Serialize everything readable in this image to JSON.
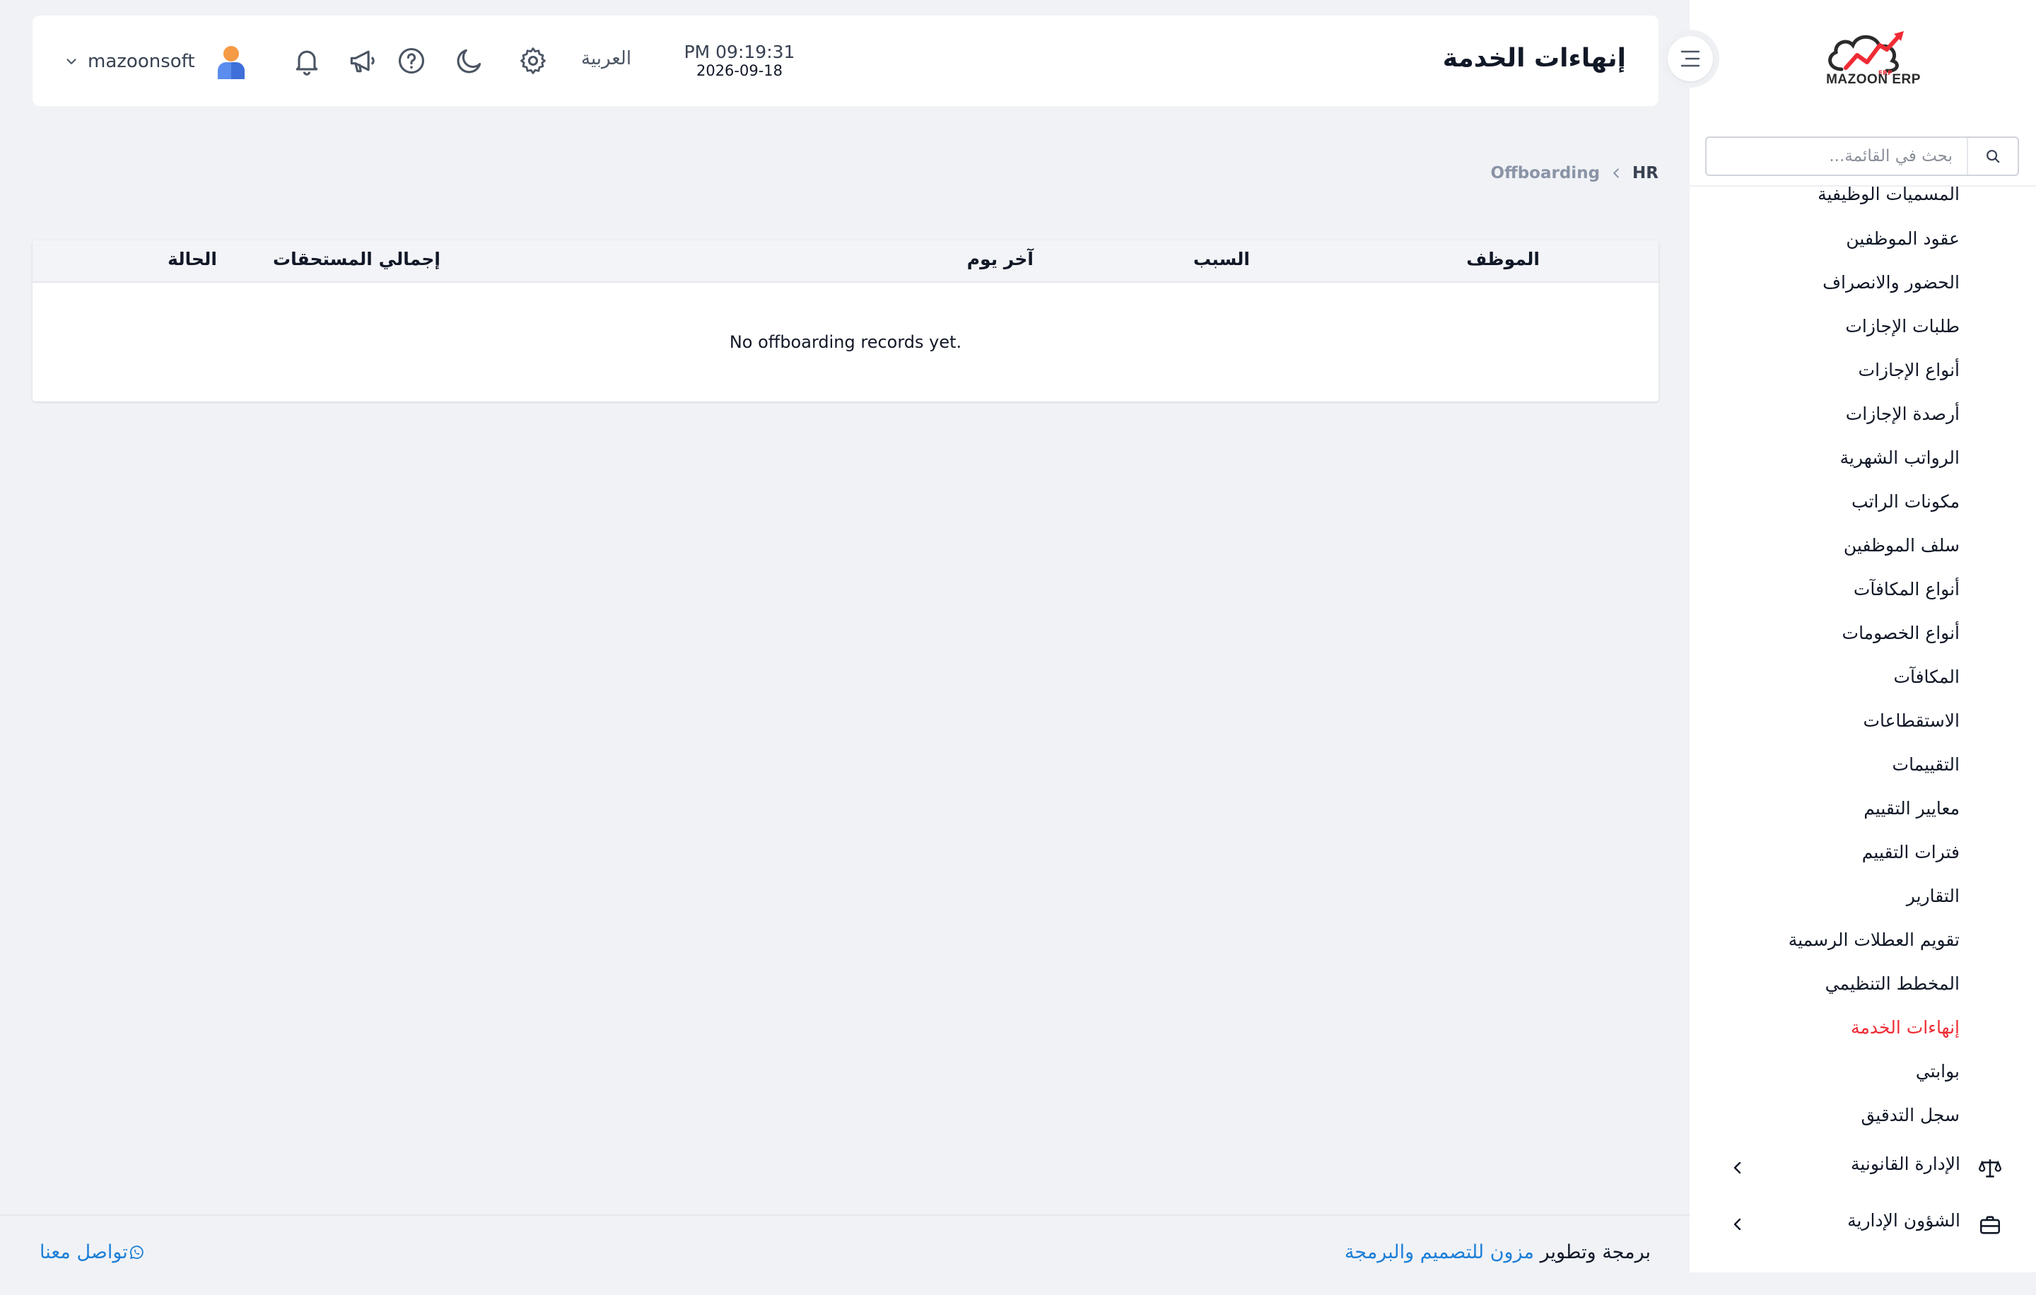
{
  "app": {
    "brand": "MAZOON ERP",
    "accent_color": "#ef2b34",
    "link_color": "#1d7fd8"
  },
  "sidebar": {
    "search_placeholder": "بحث في القائمة...",
    "items": [
      {
        "label": "المسميات الوظيفية"
      },
      {
        "label": "عقود الموظفين"
      },
      {
        "label": "الحضور والانصراف"
      },
      {
        "label": "طلبات الإجازات"
      },
      {
        "label": "أنواع الإجازات"
      },
      {
        "label": "أرصدة الإجازات"
      },
      {
        "label": "الرواتب الشهرية"
      },
      {
        "label": "مكونات الراتب"
      },
      {
        "label": "سلف الموظفين"
      },
      {
        "label": "أنواع المكافآت"
      },
      {
        "label": "أنواع الخصومات"
      },
      {
        "label": "المكافآت"
      },
      {
        "label": "الاستقطاعات"
      },
      {
        "label": "التقييمات"
      },
      {
        "label": "معايير التقييم"
      },
      {
        "label": "فترات التقييم"
      },
      {
        "label": "التقارير"
      },
      {
        "label": "تقويم العطلات الرسمية"
      },
      {
        "label": "المخطط التنظيمي"
      },
      {
        "label": "إنهاءات الخدمة",
        "active": true
      },
      {
        "label": "بوابتي"
      },
      {
        "label": "سجل التدقيق"
      }
    ],
    "groups": [
      {
        "label": "الإدارة القانونية",
        "icon": "scale-icon"
      },
      {
        "label": "الشؤون الإدارية",
        "icon": "briefcase-icon"
      }
    ]
  },
  "header": {
    "page_title": "إنهاءات الخدمة",
    "time": "PM 09:19:31",
    "date": "2026-09-18",
    "language": "العربية",
    "username": "mazoonsoft",
    "icons": [
      "settings-icon",
      "moon-icon",
      "help-icon",
      "megaphone-icon",
      "bell-icon"
    ]
  },
  "breadcrumb": {
    "root": "HR",
    "current": "Offboarding"
  },
  "table": {
    "columns": {
      "employee": "الموظف",
      "reason": "السبب",
      "last_day": "آخر يوم",
      "total_dues": "إجمالي المستحقات",
      "status": "الحالة"
    },
    "empty_message": "No offboarding records yet."
  },
  "footer": {
    "credit_prefix": "برمجة وتطوير",
    "credit_link": "مزون للتصميم والبرمجة",
    "contact": "تواصل معنا"
  }
}
